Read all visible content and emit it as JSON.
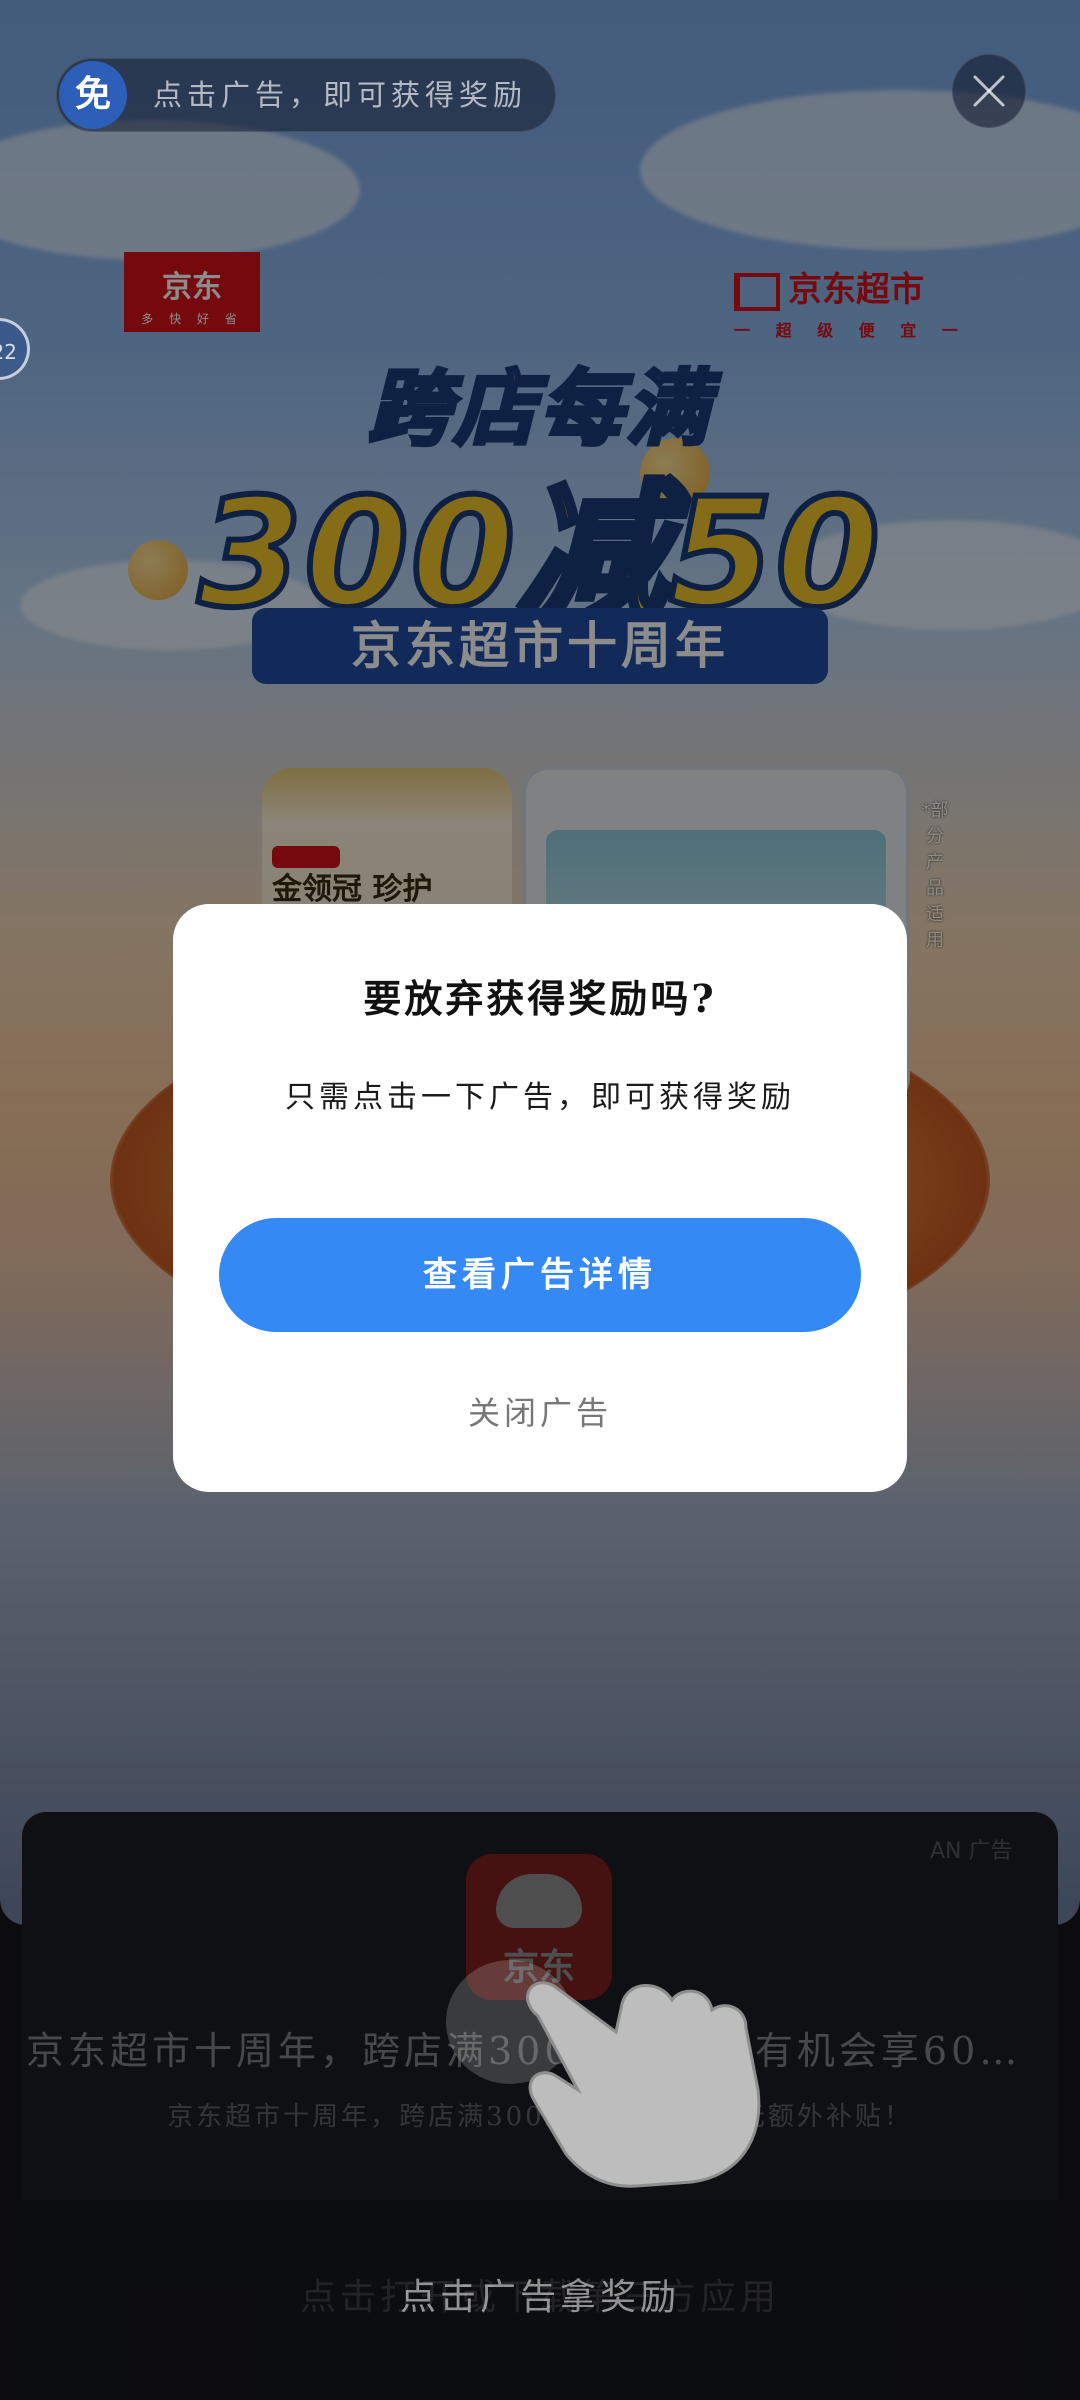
{
  "top_bar": {
    "reward_badge": "免",
    "reward_text": "点击广告，即可获得奖励",
    "timer_text": "22"
  },
  "ad_creative": {
    "brand_logo": "京东",
    "brand_slogan": "多 快 好 省",
    "market_logo": "京东超市",
    "market_slogan": "一 超 级 便 宜 一",
    "headline_line1": "跨店每满",
    "headline_line2": "300减50",
    "banner": "京东超市十周年",
    "product_label": "金领冠 珍护",
    "side_note": "*部分产品适用"
  },
  "dialog": {
    "title": "要放弃获得奖励吗?",
    "message": "只需点击一下广告，即可获得奖励",
    "primary_button": "查看广告详情",
    "secondary_button": "关闭广告"
  },
  "info_card": {
    "ad_tag": "AN 广告",
    "app_icon_text": "京东",
    "title": "京东超市十周年，跨店满300减50，还有机会享60元额外…",
    "description": "京东超市十周年，跨店满300立减50，享60元额外补贴！"
  },
  "cta": {
    "underlying_text": "点击打开或下载第三方应用",
    "overlay_text": "点击广告拿奖励"
  },
  "colors": {
    "primary_blue": "#3589f5",
    "jd_red": "#d8121b"
  }
}
